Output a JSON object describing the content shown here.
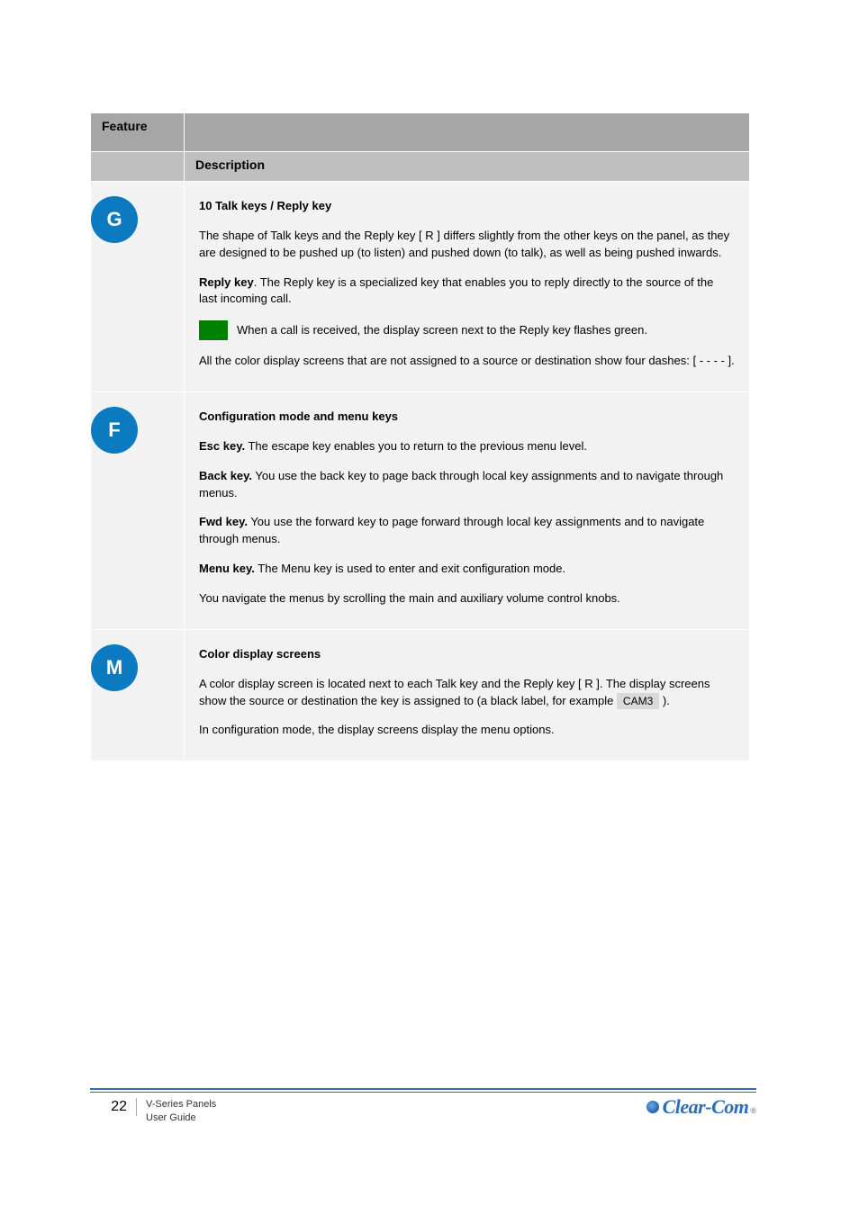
{
  "table": {
    "header_feature": "Feature",
    "header_description": "Description",
    "rows": [
      {
        "key": "G",
        "title": "10 Talk keys / Reply key",
        "paras": [
          {
            "text": "The shape of Talk keys and the Reply key [ R ] differs slightly from the other keys on the panel, as they are designed to be pushed up (to listen) and pushed down (to talk), as well as being pushed inwards."
          },
          {
            "bold": "Reply key",
            "text": ". The Reply key is a specialized key that enables you to reply directly to the source of the last incoming call."
          }
        ],
        "led": {
          "text": "When a call is received, the display screen next to the Reply key flashes green."
        },
        "paras2": [
          {
            "text": "All the color display screens that are not assigned to a source or destination show four dashes: [ - - - - ]."
          }
        ]
      },
      {
        "key": "F",
        "title": "Configuration mode and menu keys",
        "items": [
          {
            "bold": "Esc key.",
            "text": " The escape key enables you to return to the previous menu level."
          },
          {
            "bold": "Back key.",
            "text": " You use the back key to page back through local key assignments and to navigate through menus."
          },
          {
            "bold": "Fwd key.",
            "text": " You use the forward key to page forward through local key assignments and to navigate through menus."
          },
          {
            "bold": "Menu key.",
            "text": " The Menu key is used to enter and exit configuration mode."
          }
        ],
        "paras2": [
          {
            "text": "You navigate the menus by scrolling the main and auxiliary volume control knobs."
          }
        ]
      },
      {
        "key": "M",
        "title": "Color display screens",
        "paras": [
          {
            "text": "A color display screen is located next to each Talk key and the Reply key [ R ]. The display screens show the source or destination the key is assigned to (a black label, for example ",
            "dash": "CAM3",
            "text2": ")."
          },
          {
            "text": "In configuration mode, the display screens display the menu options."
          }
        ]
      }
    ]
  },
  "footer": {
    "page": "22",
    "line1": "V-Series Panels",
    "line2": "User Guide",
    "brand": "Clear-Com",
    "reg": "®"
  }
}
